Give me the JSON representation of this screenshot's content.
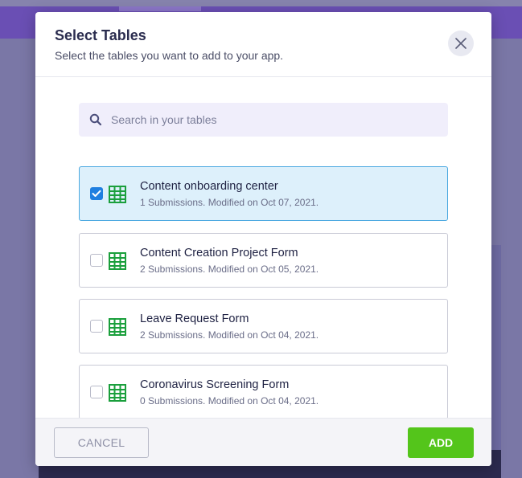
{
  "modal": {
    "title": "Select Tables",
    "subtitle": "Select the tables you want to add to your app."
  },
  "search": {
    "placeholder": "Search in your tables",
    "value": ""
  },
  "tables": [
    {
      "title": "Content onboarding center",
      "meta": "1 Submissions. Modified on Oct 07, 2021.",
      "selected": true
    },
    {
      "title": "Content Creation Project Form",
      "meta": "2 Submissions. Modified on Oct 05, 2021.",
      "selected": false
    },
    {
      "title": "Leave Request Form",
      "meta": "2 Submissions. Modified on Oct 04, 2021.",
      "selected": false
    },
    {
      "title": "Coronavirus Screening Form",
      "meta": "0 Submissions. Modified on Oct 04, 2021.",
      "selected": false
    }
  ],
  "footer": {
    "cancel_label": "CANCEL",
    "add_label": "ADD"
  },
  "icons": {
    "close": "close-icon",
    "search": "search-icon",
    "table": "spreadsheet-icon",
    "check": "checkmark-icon"
  },
  "colors": {
    "accent_green": "#54c51b",
    "selected_bg": "#ddf0fb",
    "selected_border": "#4aa8e0",
    "checkbox_blue": "#1f7fe0",
    "sheet_green": "#1a9f3c"
  }
}
